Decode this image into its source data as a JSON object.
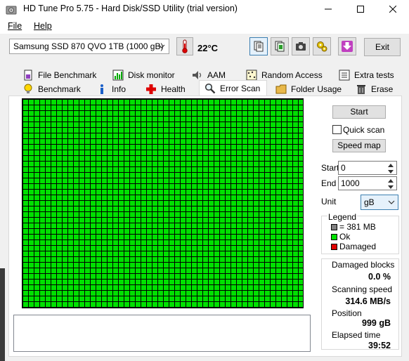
{
  "window": {
    "title": "HD Tune Pro 5.75 - Hard Disk/SSD Utility (trial version)"
  },
  "menu": {
    "file": "File",
    "help": "Help"
  },
  "toolbar": {
    "drive": "Samsung SSD 870 QVO 1TB (1000 gB)",
    "temperature": "22°C",
    "exit_label": "Exit"
  },
  "tabs_row1": [
    {
      "label": "File Benchmark",
      "icon": "file-benchmark-icon"
    },
    {
      "label": "Disk monitor",
      "icon": "disk-monitor-icon"
    },
    {
      "label": "AAM",
      "icon": "speaker-icon"
    },
    {
      "label": "Random Access",
      "icon": "random-access-icon"
    },
    {
      "label": "Extra tests",
      "icon": "extra-tests-icon"
    }
  ],
  "tabs_row2": [
    {
      "label": "Benchmark",
      "icon": "lightbulb-icon"
    },
    {
      "label": "Info",
      "icon": "info-icon"
    },
    {
      "label": "Health",
      "icon": "health-cross-icon"
    },
    {
      "label": "Error Scan",
      "icon": "magnifier-icon",
      "selected": true
    },
    {
      "label": "Folder Usage",
      "icon": "folder-icon"
    },
    {
      "label": "Erase",
      "icon": "trash-icon"
    }
  ],
  "scan": {
    "start_button": "Start",
    "quick_scan_label": "Quick scan",
    "quick_scan_checked": false,
    "speed_map_button": "Speed map",
    "start_label": "Start",
    "start_value": "0",
    "end_label": "End",
    "end_value": "1000",
    "unit_label": "Unit",
    "unit_value": "gB",
    "block_color": "#00e000",
    "damaged_color": "#e00000",
    "progress_fraction": 1.0
  },
  "legend": {
    "title": "Legend",
    "block_size": "= 381 MB",
    "ok": "Ok",
    "damaged": "Damaged"
  },
  "stats": {
    "damaged_blocks_label": "Damaged blocks",
    "damaged_blocks_value": "0.0 %",
    "scanning_speed_label": "Scanning speed",
    "scanning_speed_value": "314.6 MB/s",
    "position_label": "Position",
    "position_value": "999 gB",
    "elapsed_label": "Elapsed time",
    "elapsed_value": "39:52"
  }
}
